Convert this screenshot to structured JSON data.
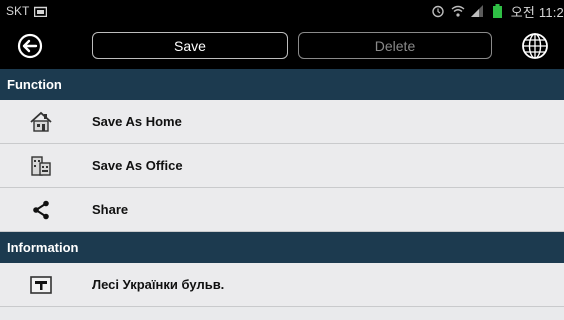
{
  "status_bar": {
    "carrier": "SKT",
    "time": "오전 11:2"
  },
  "toolbar": {
    "save_label": "Save",
    "delete_label": "Delete"
  },
  "sections": {
    "function": {
      "title": "Function",
      "items": [
        {
          "label": "Save As Home",
          "icon": "home-icon"
        },
        {
          "label": "Save As Office",
          "icon": "office-icon"
        },
        {
          "label": "Share",
          "icon": "share-icon"
        }
      ]
    },
    "information": {
      "title": "Information",
      "items": [
        {
          "label": "Лесі Українки бульв.",
          "icon": "signpost-icon"
        }
      ]
    }
  },
  "colors": {
    "section_bg": "#1c3a4f",
    "row_bg": "#ebebed",
    "toolbar_bg": "#000000"
  }
}
